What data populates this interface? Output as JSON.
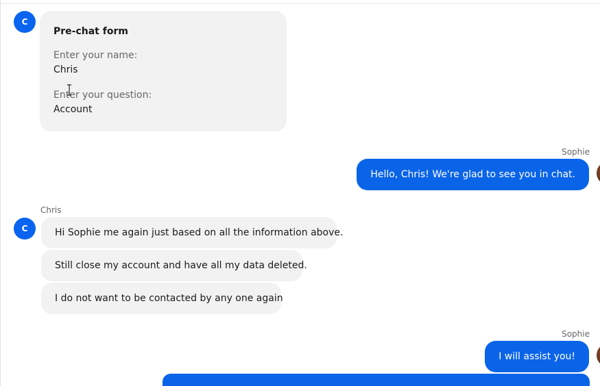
{
  "prechat_form": {
    "avatar_initial": "C",
    "title": "Pre-chat form",
    "fields": [
      {
        "label": "Enter your name:",
        "value": "Chris"
      },
      {
        "label": "Enter your question:",
        "value": "Account"
      }
    ]
  },
  "messages": [
    {
      "sender": "Sophie",
      "direction": "outgoing",
      "text": "Hello, Chris! We're glad to see you in chat."
    },
    {
      "sender": "Chris",
      "direction": "incoming",
      "avatar_initial": "C",
      "lines": [
        "Hi Sophie me again just based on all the information above.",
        "Still close my account and have all my data deleted.",
        "I do not want to be contacted by any one again"
      ]
    },
    {
      "sender": "Sophie",
      "direction": "outgoing",
      "text": "I will assist you!"
    }
  ],
  "colors": {
    "accent": "#0a64e8",
    "incoming_bubble": "#f2f2f2",
    "avatar": "#0a64f0"
  }
}
